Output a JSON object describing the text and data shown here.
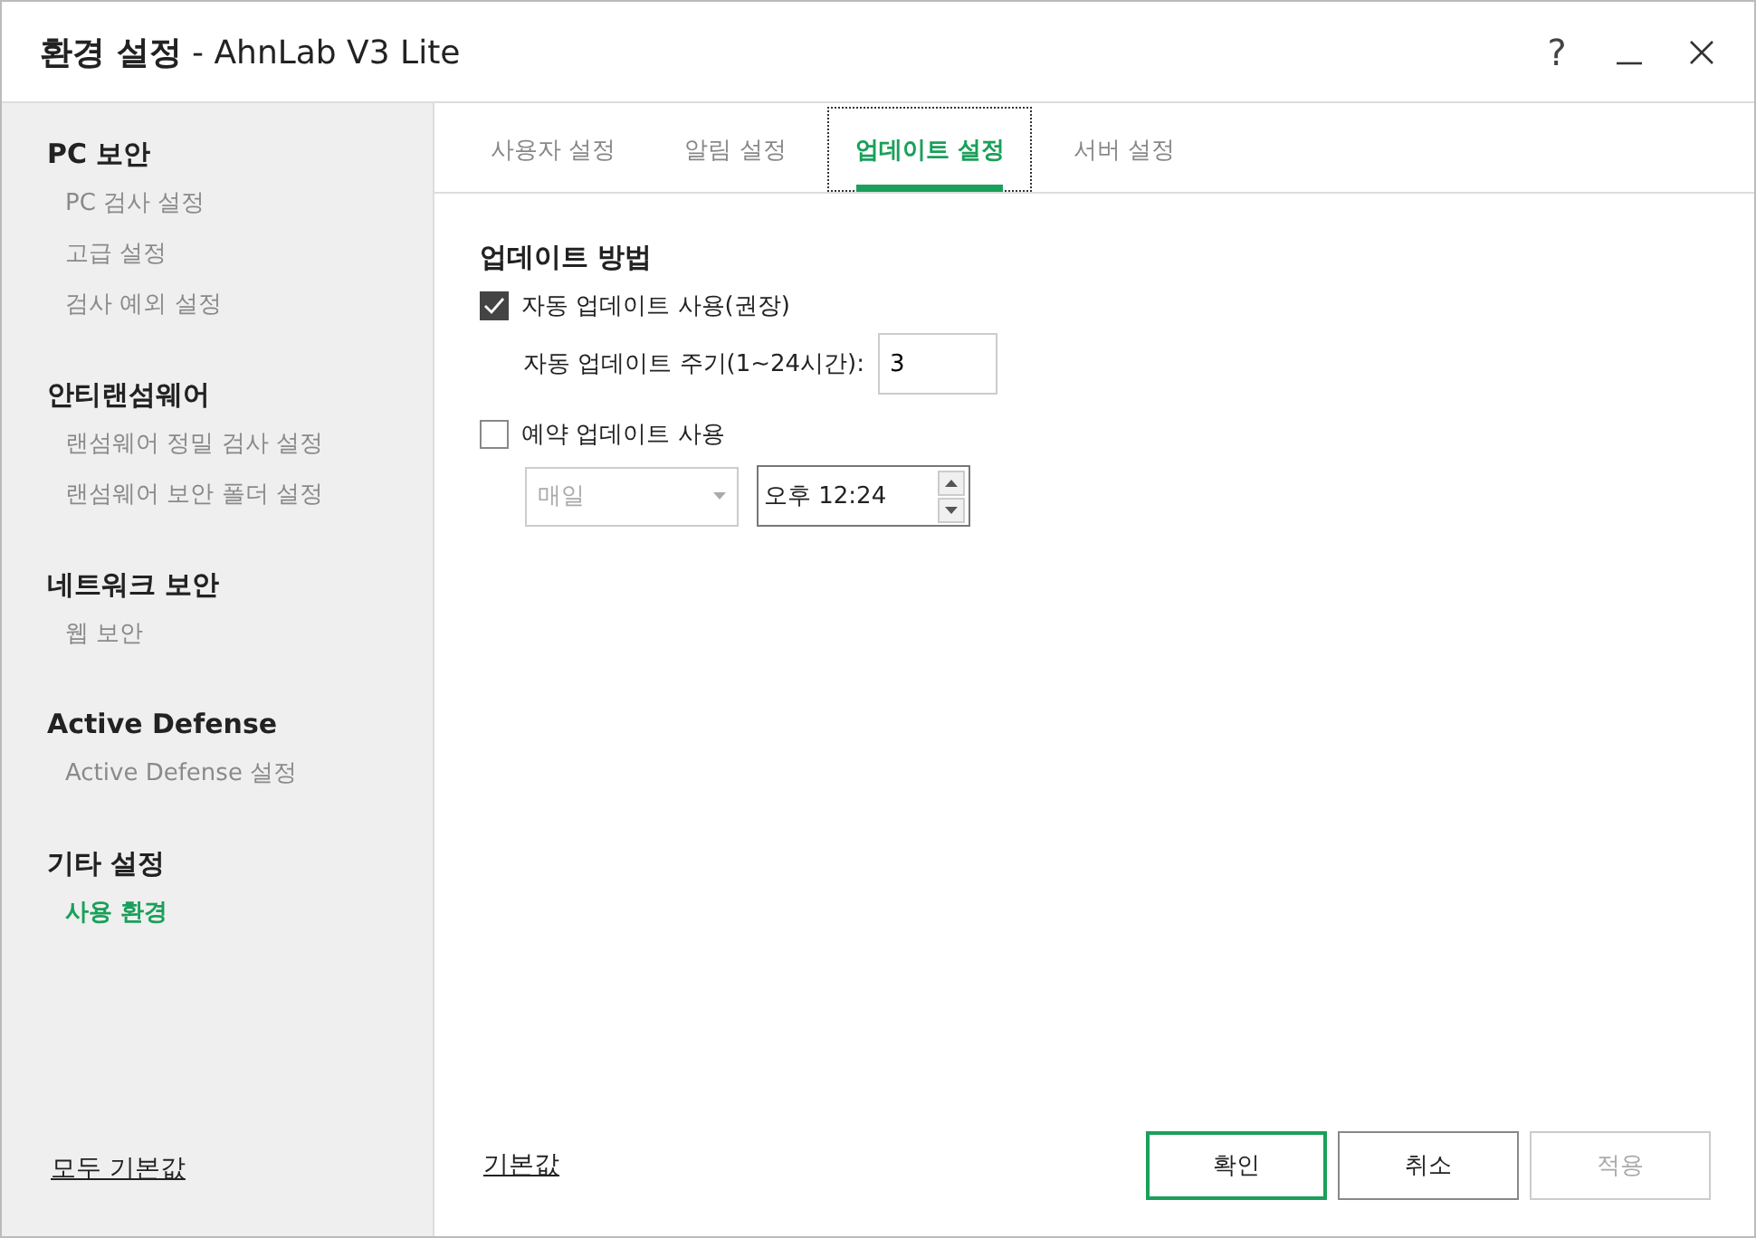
{
  "window": {
    "title": "환경 설정",
    "subtitle": "- AhnLab V3 Lite",
    "controls": [
      {
        "kind": "help",
        "label": "?"
      },
      {
        "kind": "minimize"
      },
      {
        "kind": "close"
      }
    ]
  },
  "sidebar": {
    "groups": [
      {
        "title": "PC 보안",
        "items": [
          {
            "label": "PC 검사 설정",
            "selected": false
          },
          {
            "label": "고급 설정",
            "selected": false
          },
          {
            "label": "검사 예외 설정",
            "selected": false
          }
        ]
      },
      {
        "title": "안티랜섬웨어",
        "items": [
          {
            "label": "랜섬웨어 정밀 검사 설정",
            "selected": false
          },
          {
            "label": "랜섬웨어 보안 폴더 설정",
            "selected": false
          }
        ]
      },
      {
        "title": "네트워크 보안",
        "items": [
          {
            "label": "웹 보안",
            "selected": false
          }
        ]
      },
      {
        "title": "Active Defense",
        "items": [
          {
            "label": "Active Defense 설정",
            "selected": false
          }
        ]
      },
      {
        "title": "기타 설정",
        "items": [
          {
            "label": "사용 환경",
            "selected": true
          }
        ]
      }
    ],
    "reset_all": "모두 기본값"
  },
  "tabs": [
    {
      "label": "사용자 설정",
      "selected": false
    },
    {
      "label": "알림 설정",
      "selected": false
    },
    {
      "label": "업데이트 설정",
      "selected": true
    },
    {
      "label": "서버 설정",
      "selected": false
    }
  ],
  "section": {
    "title": "업데이트 방법",
    "auto_update": {
      "label": "자동 업데이트 사용(권장)",
      "checked": true
    },
    "interval": {
      "label": "자동 업데이트 주기(1~24시간):",
      "value": "3"
    },
    "scheduled_update": {
      "label": "예약 업데이트 사용",
      "checked": false
    },
    "schedule_day": {
      "value": "매일",
      "disabled": true
    },
    "schedule_time": {
      "value": "오후 12:24"
    }
  },
  "footer": {
    "reset": "기본값",
    "buttons": [
      {
        "label": "확인",
        "kind": "primary",
        "disabled": false
      },
      {
        "label": "취소",
        "kind": "normal",
        "disabled": false
      },
      {
        "label": "적용",
        "kind": "normal",
        "disabled": true
      }
    ]
  }
}
